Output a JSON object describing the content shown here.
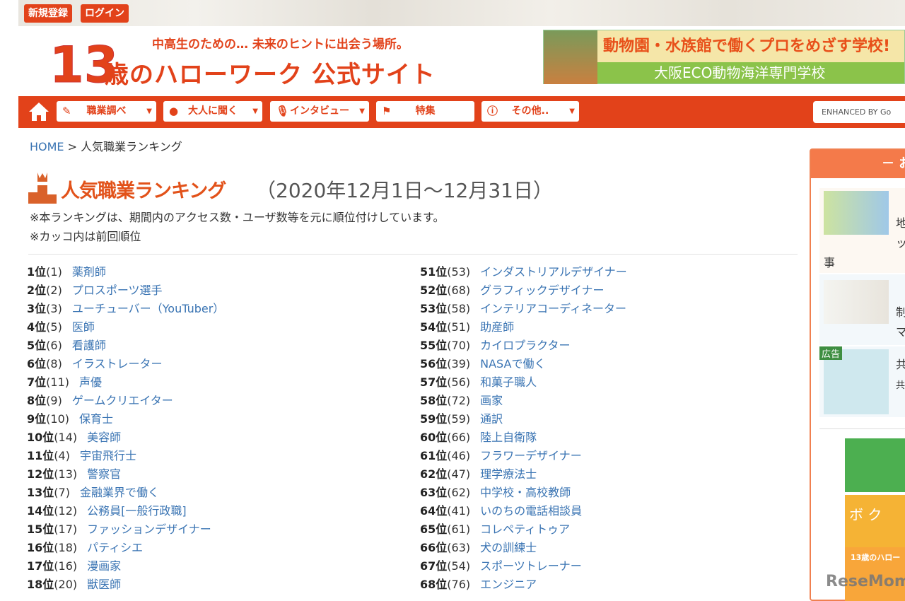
{
  "header": {
    "register": "新規登録",
    "login": "ログイン",
    "logo_tagline": "中高生のための… 未来のヒントに出会う場所。",
    "logo_number": "13",
    "logo_name": "歳のハローワーク 公式サイト",
    "ad_line1": "動物園・水族館で働くプロをめざす学校!",
    "ad_line2": "大阪ECO動物海洋専門学校"
  },
  "nav": {
    "items": [
      {
        "label": "職業調べ"
      },
      {
        "label": "大人に聞く"
      },
      {
        "label": "インタビュー"
      },
      {
        "label": "特集"
      },
      {
        "label": "その他.."
      }
    ],
    "search": "ENHANCED BY Go"
  },
  "breadcrumb": {
    "home": "HOME",
    "sep": ">",
    "current": "人気職業ランキング"
  },
  "page": {
    "title": "人気職業ランキング",
    "period": "（2020年12月1日〜12月31日）",
    "note1": "※本ランキングは、期間内のアクセス数・ユーザ数等を元に順位付けしています。",
    "note2": "※カッコ内は前回順位"
  },
  "ranking_left": [
    {
      "rank": "1位",
      "prev": "(1)",
      "name": "薬剤師"
    },
    {
      "rank": "2位",
      "prev": "(2)",
      "name": "プロスポーツ選手"
    },
    {
      "rank": "3位",
      "prev": "(3)",
      "name": "ユーチューバー（YouTuber）"
    },
    {
      "rank": "4位",
      "prev": "(5)",
      "name": "医師"
    },
    {
      "rank": "5位",
      "prev": "(6)",
      "name": "看護師"
    },
    {
      "rank": "6位",
      "prev": "(8)",
      "name": "イラストレーター"
    },
    {
      "rank": "7位",
      "prev": "(11)",
      "name": "声優"
    },
    {
      "rank": "8位",
      "prev": "(9)",
      "name": "ゲームクリエイター"
    },
    {
      "rank": "9位",
      "prev": "(10)",
      "name": "保育士"
    },
    {
      "rank": "10位",
      "prev": "(14)",
      "name": "美容師"
    },
    {
      "rank": "11位",
      "prev": "(4)",
      "name": "宇宙飛行士"
    },
    {
      "rank": "12位",
      "prev": "(13)",
      "name": "警察官"
    },
    {
      "rank": "13位",
      "prev": "(7)",
      "name": "金融業界で働く"
    },
    {
      "rank": "14位",
      "prev": "(12)",
      "name": "公務員[一般行政職]"
    },
    {
      "rank": "15位",
      "prev": "(17)",
      "name": "ファッションデザイナー"
    },
    {
      "rank": "16位",
      "prev": "(18)",
      "name": "パティシエ"
    },
    {
      "rank": "17位",
      "prev": "(16)",
      "name": "漫画家"
    },
    {
      "rank": "18位",
      "prev": "(20)",
      "name": "獣医師"
    }
  ],
  "ranking_right": [
    {
      "rank": "51位",
      "prev": "(53)",
      "name": "インダストリアルデザイナー"
    },
    {
      "rank": "52位",
      "prev": "(68)",
      "name": "グラフィックデザイナー"
    },
    {
      "rank": "53位",
      "prev": "(58)",
      "name": "インテリアコーディネーター"
    },
    {
      "rank": "54位",
      "prev": "(51)",
      "name": "助産師"
    },
    {
      "rank": "55位",
      "prev": "(70)",
      "name": "カイロプラクター"
    },
    {
      "rank": "56位",
      "prev": "(39)",
      "name": "NASAで働く"
    },
    {
      "rank": "57位",
      "prev": "(56)",
      "name": "和菓子職人"
    },
    {
      "rank": "58位",
      "prev": "(72)",
      "name": "画家"
    },
    {
      "rank": "59位",
      "prev": "(59)",
      "name": "通訳"
    },
    {
      "rank": "60位",
      "prev": "(66)",
      "name": "陸上自衛隊"
    },
    {
      "rank": "61位",
      "prev": "(46)",
      "name": "フラワーデザイナー"
    },
    {
      "rank": "62位",
      "prev": "(47)",
      "name": "理学療法士"
    },
    {
      "rank": "63位",
      "prev": "(62)",
      "name": "中学校・高校教師"
    },
    {
      "rank": "64位",
      "prev": "(41)",
      "name": "いのちの電話相談員"
    },
    {
      "rank": "65位",
      "prev": "(61)",
      "name": "コレペティトゥア"
    },
    {
      "rank": "66位",
      "prev": "(63)",
      "name": "犬の訓練士"
    },
    {
      "rank": "67位",
      "prev": "(54)",
      "name": "スポーツトレーナー"
    },
    {
      "rank": "68位",
      "prev": "(76)",
      "name": "エンジニア"
    }
  ],
  "sidebar": {
    "header": "－ お",
    "card1_a": "地",
    "card1_b": "ッ",
    "card1_c": "事",
    "card2_a": "制",
    "card2_b": "マ",
    "ad_label": "広告",
    "card3_a": "共",
    "card3_b": "共",
    "banner1": "",
    "banner2": "ボ ク",
    "banner3": "13歳のハロー"
  },
  "watermark": "ReseMom",
  "colors": {
    "brand": "#e2421a",
    "link": "#3a74b3"
  }
}
